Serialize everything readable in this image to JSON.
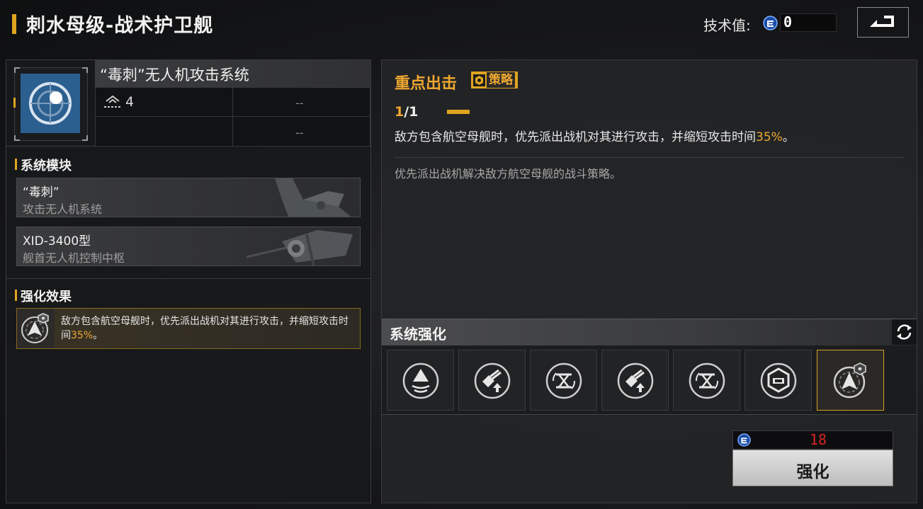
{
  "header": {
    "title": "刺水母级-战术护卫舰",
    "tech_label": "技术值:",
    "tech_value": "0",
    "back_icon": "return-arrow-icon"
  },
  "system": {
    "name": "“毒刺”无人机攻击系统",
    "icon": "crosshair-target-icon",
    "rank_icon": "rank-chevron-icon",
    "stats": [
      {
        "label": "",
        "value": "4"
      },
      {
        "label": "",
        "value": "--"
      },
      {
        "label": "",
        "value": ""
      },
      {
        "label": "",
        "value": "--"
      }
    ]
  },
  "modules_section": {
    "title": "系统模块",
    "items": [
      {
        "title": "“毒刺”",
        "subtitle": "攻击无人机系统"
      },
      {
        "title": "XID-3400型",
        "subtitle": "舰首无人机控制中枢"
      }
    ]
  },
  "effect_section": {
    "title": "强化效果",
    "text_before": "敌方包含航空母舰时，优先派出战机对其进行攻击，并缩短攻击时间",
    "text_highlight": "35%",
    "text_after": "。"
  },
  "tactic": {
    "title": "重点出击",
    "badge": "策略",
    "count_current": "1",
    "count_rest": "/1",
    "progress": 1.0,
    "desc_before": "敌方包含航空母舰时，优先派出战机对其进行攻击，并缩短攻击时间",
    "desc_highlight": "35%",
    "desc_after": "。",
    "flavor": "优先派出战机解决敌方航空母舰的战斗策略。"
  },
  "enhance": {
    "title": "系统强化",
    "refresh_icon": "refresh-icon",
    "slots": [
      {
        "icon": "radar-wave-icon",
        "selected": false
      },
      {
        "icon": "cannon-upgrade-icon",
        "selected": false
      },
      {
        "icon": "ammo-cycle-icon",
        "selected": false
      },
      {
        "icon": "cannon-upgrade-icon",
        "selected": false
      },
      {
        "icon": "ammo-cycle-icon",
        "selected": false
      },
      {
        "icon": "shield-hex-icon",
        "selected": false
      },
      {
        "icon": "aircraft-target-icon",
        "selected": true
      }
    ],
    "cost": "18",
    "upgrade_label": "强化"
  },
  "colors": {
    "accent": "#e0a520",
    "highlight": "#f0a830",
    "cost_red": "#d52424",
    "icon_blue": "#2b5f8f"
  }
}
